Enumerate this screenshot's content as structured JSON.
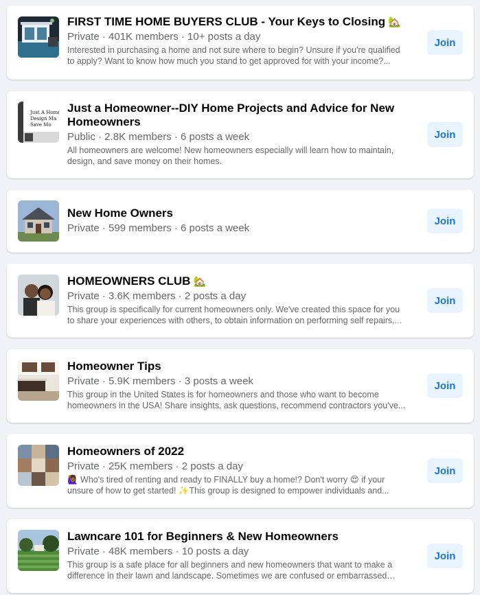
{
  "groups": [
    {
      "title": "FIRST TIME HOME BUYERS CLUB - Your Keys to Closing",
      "title_emoji": "🏡",
      "privacy": "Private",
      "members": "401K members",
      "activity": "10+ posts a day",
      "meta": "Private · 401K members · 10+ posts a day",
      "description": "Interested in purchasing a home and not sure where to begin? Unsure if you're qualified to apply? Want to know how much you stand to get approved for with your income?...",
      "join_label": "Join",
      "thumb_icon": "house-photo-thumbnail"
    },
    {
      "title": "Just a Homeowner--DIY Home Projects and Advice for New Homeowners",
      "title_emoji": "",
      "privacy": "Public",
      "members": "2.8K members",
      "activity": "6 posts a week",
      "meta": "Public · 2.8K members · 6 posts a week",
      "description": "All homeowners are welcome! New homeowners especially will learn how to maintain, design, and save money on their homes.",
      "join_label": "Join",
      "thumb_icon": "diy-sign-thumbnail",
      "thumb_text": "Just A Home\nDesign Ma\nSave Mo"
    },
    {
      "title": "New Home Owners",
      "title_emoji": "",
      "privacy": "Private",
      "members": "599 members",
      "activity": "6 posts a week",
      "meta": "Private · 599 members · 6 posts a week",
      "description": "",
      "join_label": "Join",
      "thumb_icon": "house-exterior-thumbnail"
    },
    {
      "title": "HOMEOWNERS CLUB",
      "title_emoji": "🏡",
      "privacy": "Private",
      "members": "3.6K members",
      "activity": "2 posts a day",
      "meta": "Private · 3.6K members · 2 posts a day",
      "description": "This group is specifically for current homeowners only. We've created this space for you to share your experiences with others, to obtain information on performing self repairs,...",
      "join_label": "Join",
      "thumb_icon": "couple-photo-thumbnail"
    },
    {
      "title": "Homeowner Tips",
      "title_emoji": "",
      "privacy": "Private",
      "members": "5.9K members",
      "activity": "3 posts a week",
      "meta": "Private · 5.9K members · 3 posts a week",
      "description": "This group in the United States is for homeowners and those who want to become homeowners in the USA! Share insights, ask questions, recommend contractors you've...",
      "join_label": "Join",
      "thumb_icon": "kitchen-photo-thumbnail"
    },
    {
      "title": "Homeowners of 2022",
      "title_emoji": "",
      "privacy": "Private",
      "members": "25K members",
      "activity": "2 posts a day",
      "meta": "Private · 25K members · 2 posts a day",
      "description": "🙋🏾‍♀️ Who's tired of renting and ready to FINALLY buy a home!? Don't worry 😍 if your unsure of how to get started! ✨This group is designed to empower individuals and...",
      "join_label": "Join",
      "thumb_icon": "collage-photo-thumbnail"
    },
    {
      "title": "Lawncare 101 for Beginners & New Homeowners",
      "title_emoji": "",
      "privacy": "Private",
      "members": "48K members",
      "activity": "10 posts a day",
      "meta": "Private · 48K members · 10 posts a day",
      "description": "This group is a safe place for all beginners and new homeowners that want to make a difference in their lawn and landscape. Sometimes we are confused or embarrassed wh...",
      "join_label": "Join",
      "thumb_icon": "lawn-photo-thumbnail"
    }
  ]
}
